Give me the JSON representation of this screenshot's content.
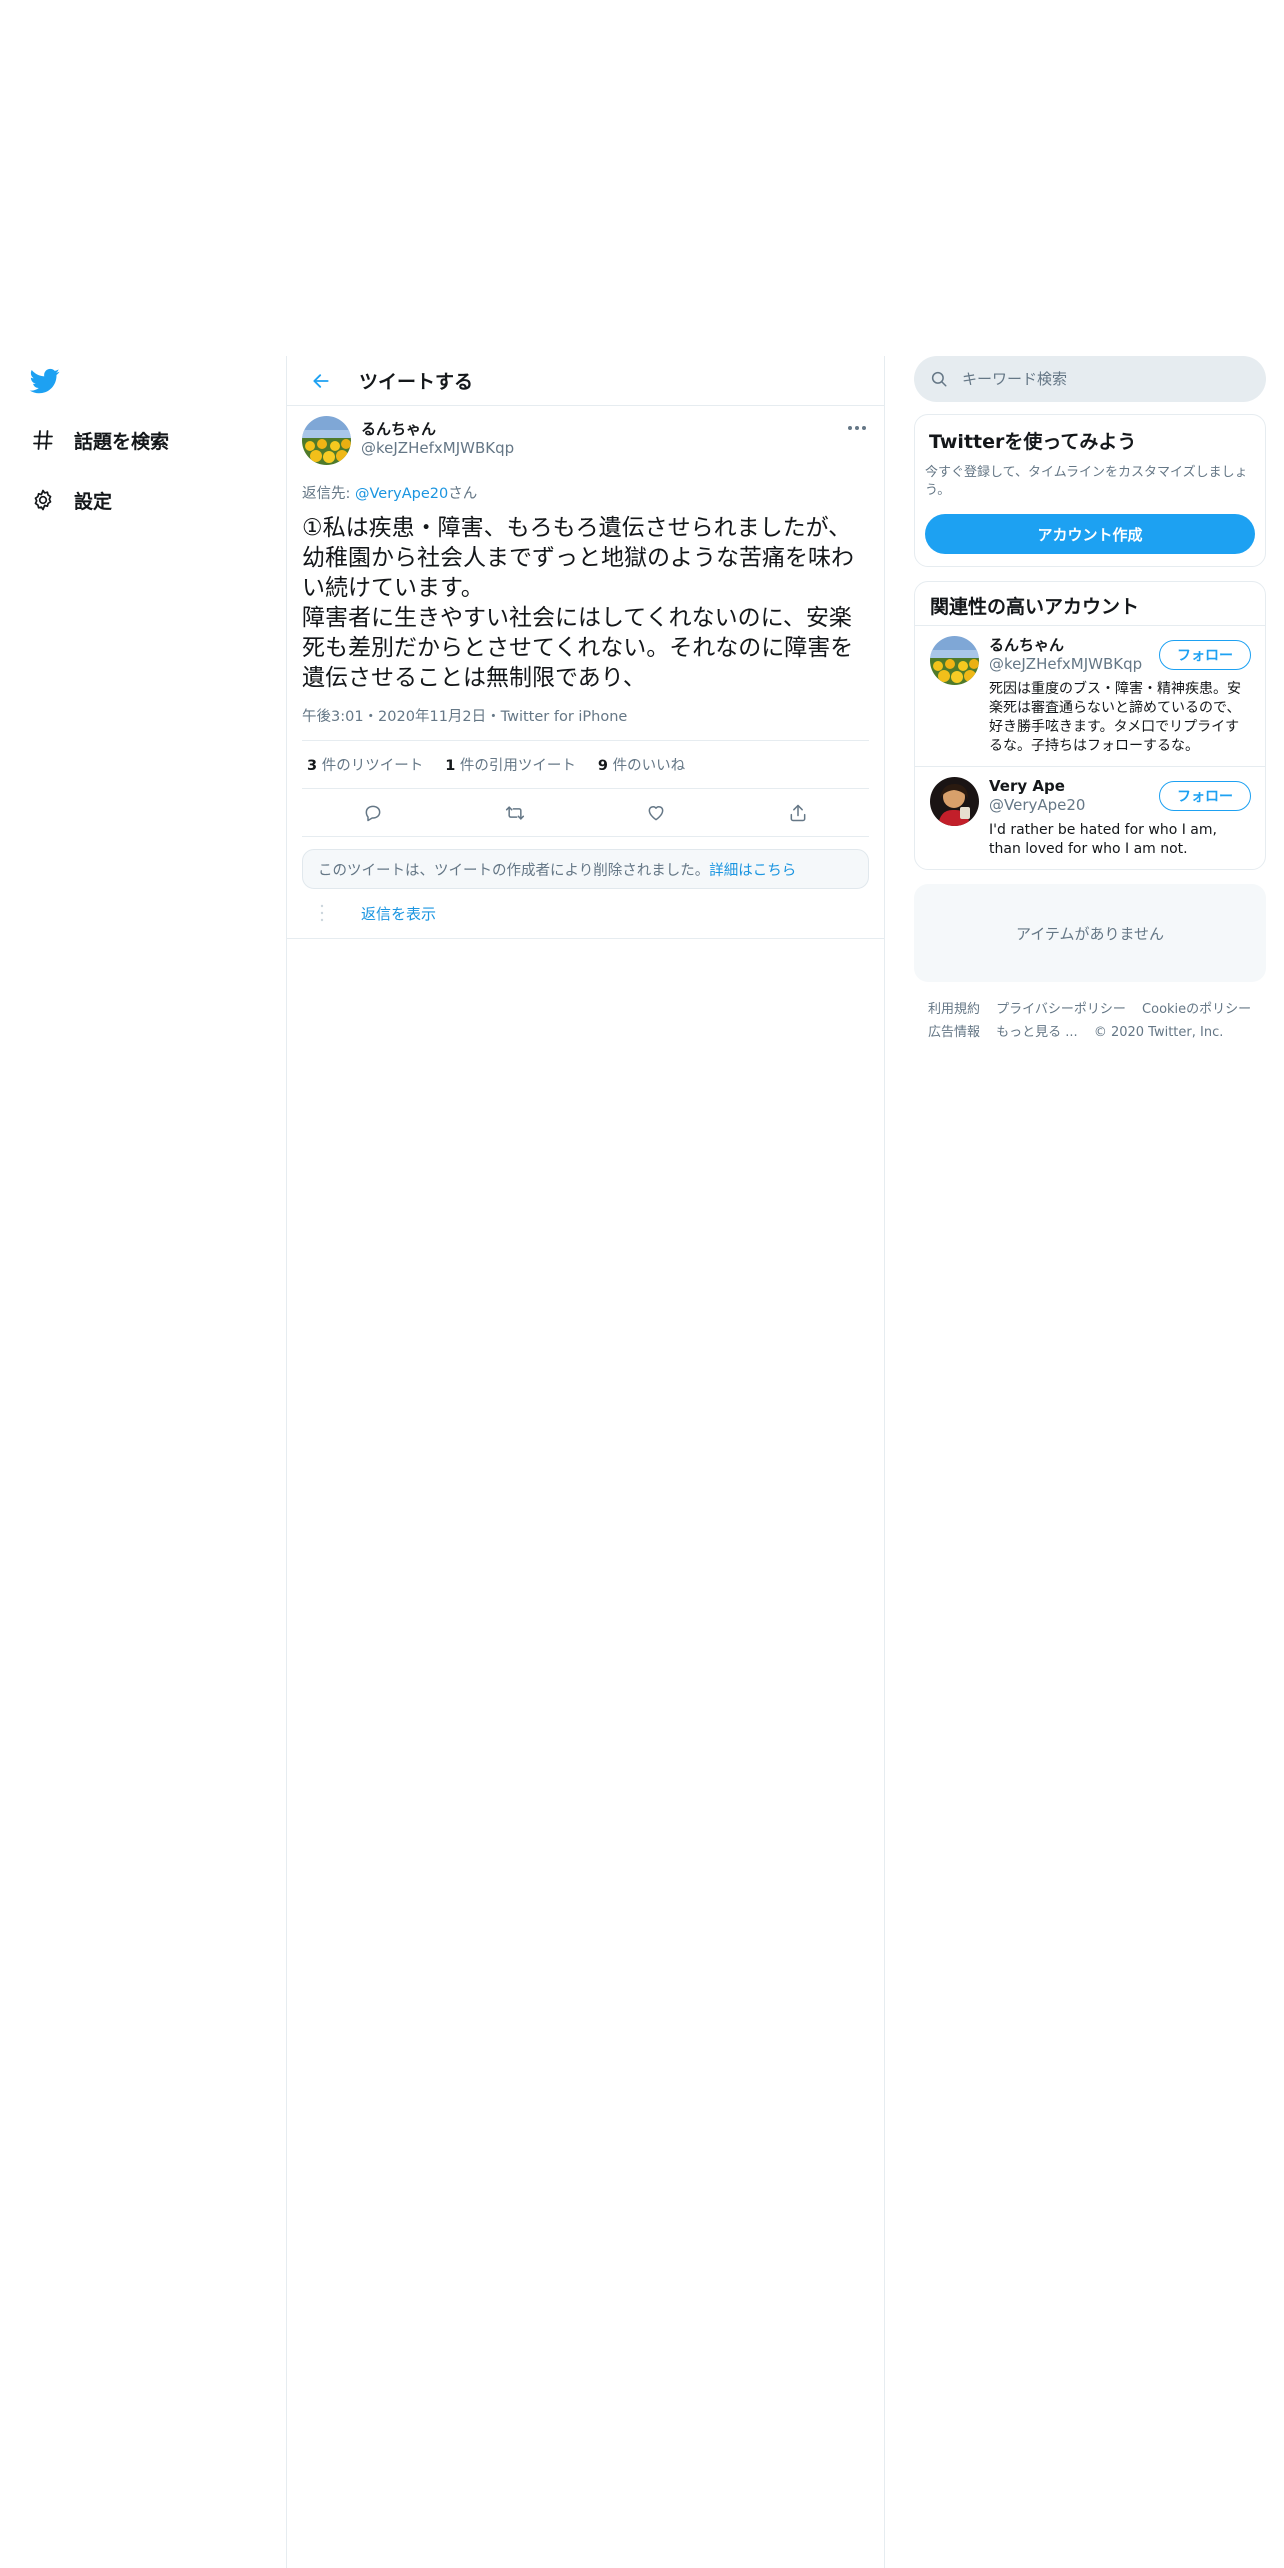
{
  "nav": {
    "logo_icon": "twitter-bird-icon",
    "items": [
      {
        "label": "話題を検索",
        "icon": "hashtag-icon"
      },
      {
        "label": "設定",
        "icon": "gear-icon"
      }
    ]
  },
  "header": {
    "title": "ツイートする"
  },
  "tweet": {
    "author_name": "るんちゃん",
    "author_handle": "@keJZHefxMJWBKqp",
    "reply_prefix": "返信先: ",
    "reply_mention": "@VeryApe20",
    "reply_suffix": "さん",
    "text": "①私は疾患・障害、もろもろ遺伝させられましたが、幼稚園から社会人までずっと地獄のような苦痛を味わい続けています。\n障害者に生きやすい社会にはしてくれないのに、安楽死も差別だからとさせてくれない。それなのに障害を遺伝させることは無制限であり、",
    "meta": "午後3:01・2020年11月2日・Twitter for iPhone",
    "stats": [
      {
        "num": "3",
        "label": " 件のリツイート"
      },
      {
        "num": "1",
        "label": " 件の引用ツイート"
      },
      {
        "num": "9",
        "label": " 件のいいね"
      }
    ],
    "deleted_notice": "このツイートは、ツイートの作成者により削除されました。",
    "deleted_link": "詳細はこちら",
    "show_replies": "返信を表示"
  },
  "sidebar": {
    "search_placeholder": "キーワード検索",
    "signup": {
      "title": "Twitterを使ってみよう",
      "desc": "今すぐ登録して、タイムラインをカスタマイズしましょう。",
      "button": "アカウント作成"
    },
    "related": {
      "title": "関連性の高いアカウント",
      "accounts": [
        {
          "name": "るんちゃん",
          "handle": "@keJZHefxMJWBKqp",
          "bio": "死因は重度のブス・障害・精神疾患。安楽死は審査通らないと諦めているので、好き勝手呟きます。タメ口でリプライするな。子持ちはフォローするな。",
          "follow": "フォロー"
        },
        {
          "name": "Very Ape",
          "handle": "@VeryApe20",
          "bio": "I'd rather be hated for who I am, than loved for who I am not.",
          "follow": "フォロー"
        }
      ]
    },
    "empty": "アイテムがありません",
    "footer": {
      "links": [
        "利用規約",
        "プライバシーポリシー",
        "Cookieのポリシー",
        "広告情報",
        "もっと見る ..."
      ],
      "copyright": "© 2020 Twitter, Inc."
    }
  },
  "colors": {
    "accent": "#1da1f2",
    "link": "#1b95e0",
    "muted": "#657786",
    "border": "#e6ecf0"
  }
}
